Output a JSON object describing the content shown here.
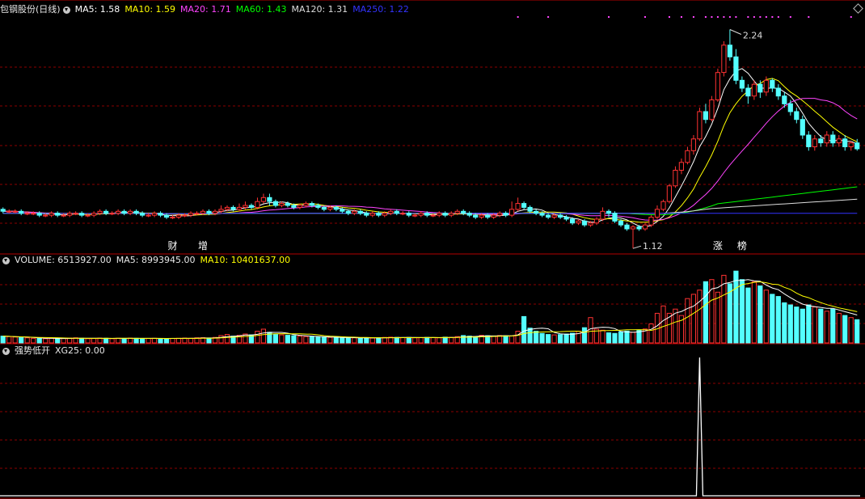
{
  "main_header": {
    "stock_name": "包钢股份",
    "period": "(日线)",
    "ma": [
      {
        "label": "MA5: 1.58",
        "color": "#ffffff"
      },
      {
        "label": "MA10: 1.59",
        "color": "#ffff00"
      },
      {
        "label": "MA20: 1.71",
        "color": "#ff44ff"
      },
      {
        "label": "MA60: 1.43",
        "color": "#00ff00"
      },
      {
        "label": "MA120: 1.31",
        "color": "#dddddd"
      },
      {
        "label": "MA250: 1.22",
        "color": "#3333ff"
      }
    ]
  },
  "volume_header": {
    "volume": "VOLUME: 6513927.00",
    "ma5": "MA5: 8993945.00",
    "ma10": "MA10: 10401637.00"
  },
  "indicator_header": {
    "name": "强势低开",
    "value": "XG25: 0.00"
  },
  "annotations": {
    "high_label": "2.24",
    "low_label": "1.12",
    "markers": [
      {
        "text": "财",
        "color": "#ffffff"
      },
      {
        "text": "增",
        "color": "#ffffff"
      },
      {
        "text": "涨",
        "color": "#ffffff"
      },
      {
        "text": "榜",
        "color": "#ffffff"
      }
    ]
  },
  "colors": {
    "up": "#ff3232",
    "down": "#54ffff",
    "grid": "#8b0000",
    "frame": "#b40000",
    "signal": "#ffffff",
    "dots": "#ff44ff"
  },
  "chart_data": {
    "type": "candlestick",
    "price_range": [
      1.1,
      2.3
    ],
    "high": 2.24,
    "low": 1.12,
    "marker_positions": [
      28,
      33,
      118,
      122
    ],
    "top_dot_indices": [
      85,
      90,
      100,
      106,
      110,
      112,
      114,
      116,
      117,
      118,
      119,
      120,
      121,
      123,
      124,
      125,
      126,
      127,
      128,
      130,
      133,
      140
    ],
    "candles": [
      [
        1.32,
        1.31,
        1.33,
        1.3
      ],
      [
        1.31,
        1.31,
        1.32,
        1.3
      ],
      [
        1.31,
        1.31,
        1.32,
        1.3
      ],
      [
        1.31,
        1.3,
        1.32,
        1.29
      ],
      [
        1.3,
        1.3,
        1.31,
        1.29
      ],
      [
        1.3,
        1.3,
        1.31,
        1.29
      ],
      [
        1.3,
        1.29,
        1.31,
        1.28
      ],
      [
        1.29,
        1.29,
        1.3,
        1.28
      ],
      [
        1.29,
        1.3,
        1.31,
        1.28
      ],
      [
        1.3,
        1.29,
        1.31,
        1.28
      ],
      [
        1.29,
        1.29,
        1.3,
        1.28
      ],
      [
        1.29,
        1.3,
        1.31,
        1.28
      ],
      [
        1.3,
        1.3,
        1.31,
        1.29
      ],
      [
        1.3,
        1.29,
        1.31,
        1.28
      ],
      [
        1.29,
        1.29,
        1.3,
        1.28
      ],
      [
        1.29,
        1.3,
        1.31,
        1.28
      ],
      [
        1.3,
        1.31,
        1.32,
        1.29
      ],
      [
        1.31,
        1.3,
        1.32,
        1.29
      ],
      [
        1.3,
        1.3,
        1.31,
        1.29
      ],
      [
        1.3,
        1.31,
        1.32,
        1.29
      ],
      [
        1.31,
        1.3,
        1.32,
        1.29
      ],
      [
        1.3,
        1.31,
        1.32,
        1.29
      ],
      [
        1.31,
        1.3,
        1.32,
        1.29
      ],
      [
        1.3,
        1.29,
        1.31,
        1.28
      ],
      [
        1.29,
        1.29,
        1.3,
        1.28
      ],
      [
        1.29,
        1.3,
        1.31,
        1.28
      ],
      [
        1.3,
        1.29,
        1.31,
        1.28
      ],
      [
        1.29,
        1.28,
        1.3,
        1.27
      ],
      [
        1.28,
        1.28,
        1.29,
        1.27
      ],
      [
        1.28,
        1.29,
        1.3,
        1.27
      ],
      [
        1.29,
        1.29,
        1.3,
        1.28
      ],
      [
        1.29,
        1.3,
        1.31,
        1.28
      ],
      [
        1.3,
        1.3,
        1.31,
        1.29
      ],
      [
        1.3,
        1.31,
        1.32,
        1.29
      ],
      [
        1.31,
        1.3,
        1.32,
        1.29
      ],
      [
        1.3,
        1.31,
        1.32,
        1.29
      ],
      [
        1.31,
        1.32,
        1.34,
        1.3
      ],
      [
        1.32,
        1.33,
        1.34,
        1.31
      ],
      [
        1.33,
        1.32,
        1.34,
        1.31
      ],
      [
        1.32,
        1.33,
        1.35,
        1.31
      ],
      [
        1.33,
        1.34,
        1.36,
        1.32
      ],
      [
        1.34,
        1.33,
        1.35,
        1.32
      ],
      [
        1.33,
        1.36,
        1.38,
        1.32
      ],
      [
        1.36,
        1.38,
        1.4,
        1.35
      ],
      [
        1.38,
        1.36,
        1.4,
        1.34
      ],
      [
        1.36,
        1.34,
        1.37,
        1.33
      ],
      [
        1.34,
        1.35,
        1.36,
        1.33
      ],
      [
        1.35,
        1.34,
        1.36,
        1.33
      ],
      [
        1.34,
        1.33,
        1.35,
        1.32
      ],
      [
        1.33,
        1.34,
        1.35,
        1.32
      ],
      [
        1.34,
        1.35,
        1.36,
        1.33
      ],
      [
        1.35,
        1.34,
        1.36,
        1.33
      ],
      [
        1.34,
        1.33,
        1.35,
        1.32
      ],
      [
        1.33,
        1.32,
        1.34,
        1.31
      ],
      [
        1.32,
        1.33,
        1.34,
        1.31
      ],
      [
        1.33,
        1.32,
        1.34,
        1.31
      ],
      [
        1.32,
        1.31,
        1.33,
        1.3
      ],
      [
        1.31,
        1.3,
        1.32,
        1.29
      ],
      [
        1.3,
        1.31,
        1.32,
        1.29
      ],
      [
        1.31,
        1.3,
        1.32,
        1.29
      ],
      [
        1.3,
        1.29,
        1.31,
        1.28
      ],
      [
        1.29,
        1.3,
        1.31,
        1.28
      ],
      [
        1.3,
        1.29,
        1.31,
        1.28
      ],
      [
        1.29,
        1.3,
        1.31,
        1.28
      ],
      [
        1.3,
        1.31,
        1.32,
        1.29
      ],
      [
        1.31,
        1.3,
        1.32,
        1.29
      ],
      [
        1.3,
        1.3,
        1.31,
        1.29
      ],
      [
        1.3,
        1.29,
        1.31,
        1.28
      ],
      [
        1.29,
        1.29,
        1.3,
        1.28
      ],
      [
        1.29,
        1.3,
        1.31,
        1.28
      ],
      [
        1.3,
        1.29,
        1.31,
        1.28
      ],
      [
        1.29,
        1.29,
        1.3,
        1.28
      ],
      [
        1.29,
        1.3,
        1.31,
        1.28
      ],
      [
        1.3,
        1.29,
        1.31,
        1.28
      ],
      [
        1.29,
        1.3,
        1.31,
        1.28
      ],
      [
        1.3,
        1.31,
        1.32,
        1.29
      ],
      [
        1.31,
        1.3,
        1.32,
        1.29
      ],
      [
        1.3,
        1.29,
        1.31,
        1.28
      ],
      [
        1.29,
        1.28,
        1.3,
        1.27
      ],
      [
        1.28,
        1.29,
        1.3,
        1.27
      ],
      [
        1.29,
        1.28,
        1.3,
        1.27
      ],
      [
        1.28,
        1.29,
        1.3,
        1.27
      ],
      [
        1.29,
        1.3,
        1.31,
        1.28
      ],
      [
        1.3,
        1.29,
        1.31,
        1.28
      ],
      [
        1.29,
        1.32,
        1.36,
        1.28
      ],
      [
        1.32,
        1.35,
        1.38,
        1.31
      ],
      [
        1.35,
        1.33,
        1.36,
        1.32
      ],
      [
        1.33,
        1.31,
        1.34,
        1.3
      ],
      [
        1.31,
        1.3,
        1.32,
        1.29
      ],
      [
        1.3,
        1.29,
        1.31,
        1.28
      ],
      [
        1.29,
        1.28,
        1.3,
        1.27
      ],
      [
        1.28,
        1.29,
        1.3,
        1.27
      ],
      [
        1.29,
        1.28,
        1.3,
        1.27
      ],
      [
        1.28,
        1.27,
        1.29,
        1.26
      ],
      [
        1.27,
        1.25,
        1.28,
        1.24
      ],
      [
        1.25,
        1.26,
        1.27,
        1.24
      ],
      [
        1.26,
        1.24,
        1.27,
        1.23
      ],
      [
        1.24,
        1.25,
        1.26,
        1.23
      ],
      [
        1.25,
        1.27,
        1.28,
        1.24
      ],
      [
        1.27,
        1.31,
        1.33,
        1.26
      ],
      [
        1.31,
        1.3,
        1.32,
        1.28
      ],
      [
        1.3,
        1.26,
        1.31,
        1.25
      ],
      [
        1.26,
        1.24,
        1.27,
        1.23
      ],
      [
        1.24,
        1.22,
        1.25,
        1.21
      ],
      [
        1.22,
        1.23,
        1.24,
        1.12
      ],
      [
        1.23,
        1.22,
        1.24,
        1.21
      ],
      [
        1.22,
        1.24,
        1.25,
        1.21
      ],
      [
        1.24,
        1.28,
        1.29,
        1.23
      ],
      [
        1.28,
        1.32,
        1.34,
        1.27
      ],
      [
        1.32,
        1.36,
        1.37,
        1.31
      ],
      [
        1.36,
        1.44,
        1.45,
        1.35
      ],
      [
        1.44,
        1.52,
        1.54,
        1.43
      ],
      [
        1.52,
        1.56,
        1.58,
        1.5
      ],
      [
        1.56,
        1.62,
        1.64,
        1.55
      ],
      [
        1.62,
        1.68,
        1.7,
        1.6
      ],
      [
        1.68,
        1.82,
        1.84,
        1.67
      ],
      [
        1.82,
        1.78,
        1.86,
        1.76
      ],
      [
        1.78,
        1.88,
        1.9,
        1.77
      ],
      [
        1.88,
        2.02,
        2.04,
        1.87
      ],
      [
        2.02,
        2.16,
        2.18,
        2.0
      ],
      [
        2.16,
        2.1,
        2.24,
        2.08
      ],
      [
        2.1,
        1.98,
        2.14,
        1.96
      ],
      [
        1.98,
        1.94,
        2.0,
        1.92
      ],
      [
        1.94,
        1.9,
        1.96,
        1.86
      ],
      [
        1.9,
        1.96,
        1.98,
        1.88
      ],
      [
        1.96,
        1.92,
        1.98,
        1.89
      ],
      [
        1.92,
        1.98,
        2.0,
        1.9
      ],
      [
        1.98,
        1.94,
        1.99,
        1.92
      ],
      [
        1.94,
        1.9,
        1.96,
        1.88
      ],
      [
        1.9,
        1.86,
        1.92,
        1.84
      ],
      [
        1.86,
        1.82,
        1.88,
        1.8
      ],
      [
        1.82,
        1.78,
        1.84,
        1.76
      ],
      [
        1.78,
        1.7,
        1.8,
        1.68
      ],
      [
        1.7,
        1.64,
        1.72,
        1.62
      ],
      [
        1.64,
        1.68,
        1.7,
        1.62
      ],
      [
        1.68,
        1.66,
        1.7,
        1.64
      ],
      [
        1.66,
        1.7,
        1.72,
        1.64
      ],
      [
        1.7,
        1.66,
        1.72,
        1.64
      ],
      [
        1.66,
        1.68,
        1.7,
        1.64
      ],
      [
        1.68,
        1.64,
        1.7,
        1.62
      ],
      [
        1.64,
        1.66,
        1.67,
        1.62
      ],
      [
        1.66,
        1.63,
        1.68,
        1.62
      ]
    ],
    "volume_range": [
      0,
      36000000
    ],
    "volumes": [
      3.2,
      3.0,
      2.8,
      2.5,
      2.4,
      2.2,
      2.1,
      2.0,
      2.2,
      2.0,
      2.1,
      2.3,
      2.4,
      2.2,
      2.0,
      2.1,
      2.3,
      2.2,
      2.0,
      2.2,
      2.1,
      2.3,
      2.2,
      2.0,
      2.1,
      2.2,
      2.1,
      2.0,
      2.1,
      2.2,
      2.3,
      2.2,
      2.4,
      2.5,
      2.3,
      2.6,
      3.5,
      4.0,
      3.2,
      3.6,
      4.2,
      3.8,
      5.5,
      6.5,
      5.0,
      4.0,
      3.8,
      3.6,
      3.4,
      3.2,
      3.0,
      2.9,
      2.8,
      2.7,
      2.6,
      2.5,
      2.4,
      2.5,
      2.4,
      2.3,
      2.4,
      2.3,
      2.5,
      2.6,
      2.7,
      2.6,
      2.5,
      2.6,
      2.4,
      2.5,
      2.6,
      2.5,
      2.4,
      2.7,
      2.6,
      3.0,
      3.5,
      3.2,
      3.0,
      3.6,
      3.4,
      3.2,
      3.5,
      3.4,
      3.3,
      5.5,
      12.5,
      7.0,
      5.5,
      4.5,
      4.0,
      3.8,
      3.9,
      4.2,
      4.6,
      5.5,
      7.2,
      12.0,
      6.5,
      6.0,
      4.8,
      4.5,
      5.2,
      5.6,
      5.0,
      6.0,
      6.6,
      9.0,
      14.0,
      17.5,
      14.0,
      16.0,
      13.0,
      21.0,
      23.0,
      25.0,
      29.0,
      30.0,
      24.0,
      32.0,
      28.0,
      34.0,
      30.0,
      26.0,
      29.0,
      27.0,
      25.0,
      23.0,
      22.0,
      19.0,
      18.0,
      17.0,
      16.0,
      18.0,
      17.0,
      16.0,
      15.0,
      16.0,
      14.0,
      13.0,
      12.0,
      11.0
    ],
    "volume_unit": 1000000,
    "signal_index": 115,
    "signal_range": [
      0,
      1
    ]
  }
}
